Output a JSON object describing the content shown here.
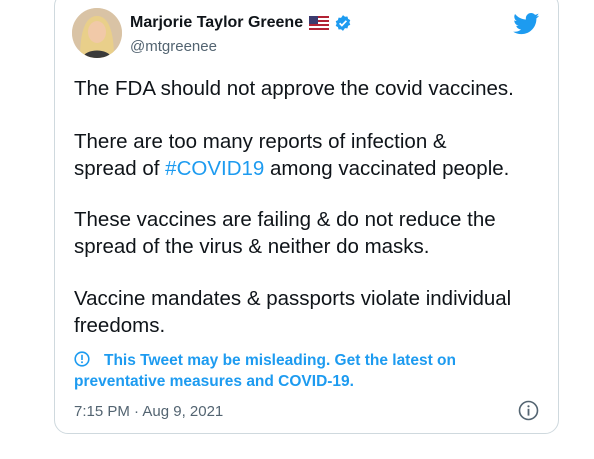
{
  "tweet": {
    "author_name": "Marjorie Taylor Greene",
    "handle": "@mtgreenee",
    "paragraphs": {
      "p1": "The FDA should not approve the covid vaccines.",
      "p2_line1": "There are too many reports of infection &",
      "p2_line2_pre": "spread of ",
      "p2_hashtag": "#COVID19",
      "p2_line2_post": " among vaccinated people.",
      "p3_line1": "These vaccines are failing & do not reduce the",
      "p3_line2": "spread of the virus & neither do masks.",
      "p4_line1": "Vaccine mandates & passports violate individual",
      "p4_line2": "freedoms."
    },
    "notice_line1": "This Tweet may be misleading. Get the latest on",
    "notice_line2": "preventative measures and COVID-19.",
    "timestamp": "7:15 PM · Aug 9, 2021"
  },
  "icons": {
    "flag": "us-flag-icon",
    "verified": "verified-badge-icon",
    "logo": "twitter-bird-icon",
    "notice": "exclamation-circle-icon",
    "info": "info-icon"
  },
  "colors": {
    "accent": "#1d9bf0",
    "text": "#0f1419",
    "secondary": "#536471",
    "border": "#cfd9de"
  }
}
